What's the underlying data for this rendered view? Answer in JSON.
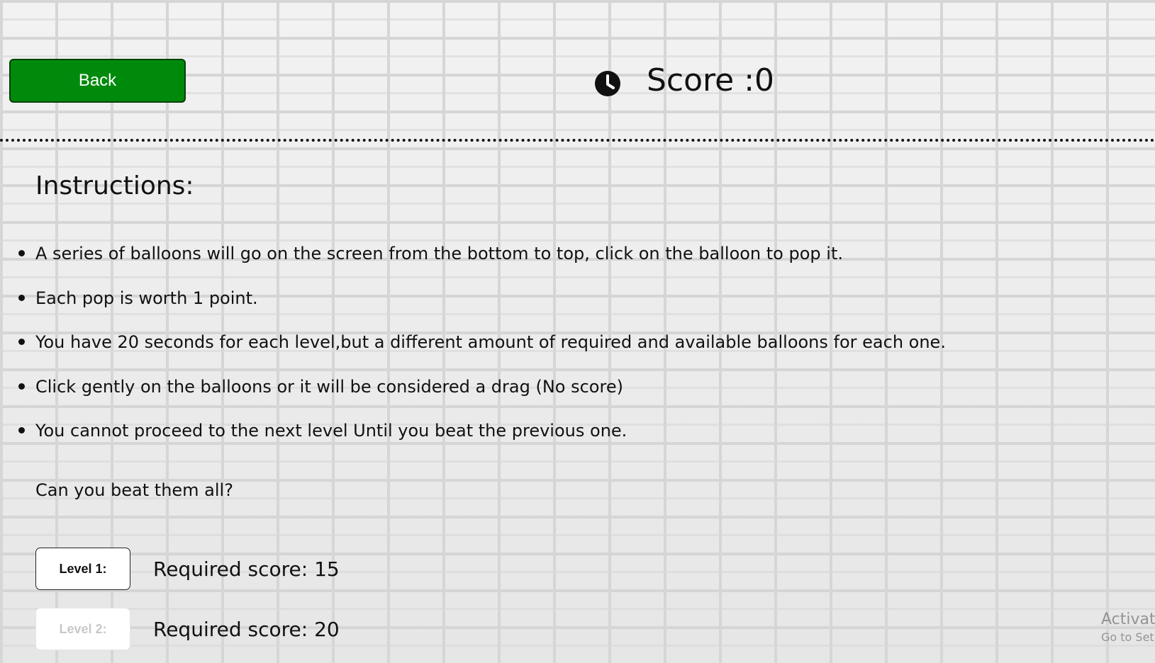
{
  "header": {
    "back_label": "Back",
    "score_label": "Score :0"
  },
  "instructions": {
    "title": "Instructions:",
    "items": [
      "A series of balloons will go on the screen from the bottom to top, click on the balloon to pop it.",
      "Each pop is worth 1 point.",
      "You have 20 seconds for each level,but a different amount of required and available balloons for each one.",
      "Click gently on the balloons or it will be considered a drag (No score)",
      "You cannot proceed to the next level Until you beat the previous one."
    ],
    "question": "Can you beat them all?"
  },
  "levels": [
    {
      "label": "Level 1:",
      "required": "Required score: 15",
      "enabled": true
    },
    {
      "label": "Level 2:",
      "required": "Required score: 20",
      "enabled": false
    }
  ],
  "watermark": {
    "title": "Activat",
    "subtitle": "Go to Set"
  },
  "colors": {
    "back_button": "#008a0c",
    "back_button_border": "#033f08",
    "text": "#111111",
    "background": "#ededed"
  },
  "icons": {
    "timer": "clock-icon"
  }
}
